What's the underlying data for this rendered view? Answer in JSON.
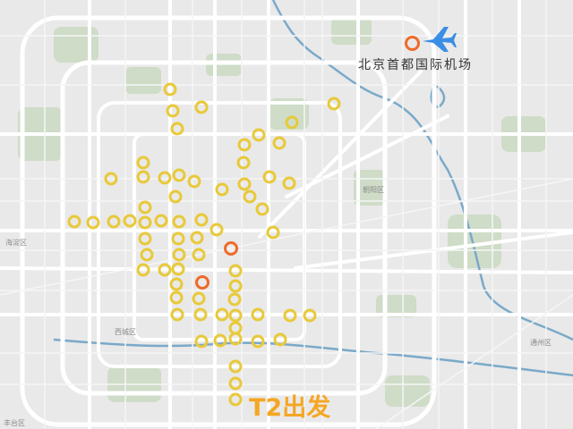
{
  "map": {
    "airport_label": "北京首都国际机场",
    "caption": "T2出发",
    "district_labels": [
      "海淀区",
      "西城区",
      "朝阳区",
      "通州区",
      "丰台区"
    ],
    "airport_icon": "airplane-icon",
    "colors": {
      "marker_yellow": "#e8c93a",
      "marker_orange": "#ee6a2a",
      "caption": "#f5a623",
      "plane": "#3b8ee6",
      "water": "#7aa9c9",
      "green": "#cfdcc8"
    }
  }
}
